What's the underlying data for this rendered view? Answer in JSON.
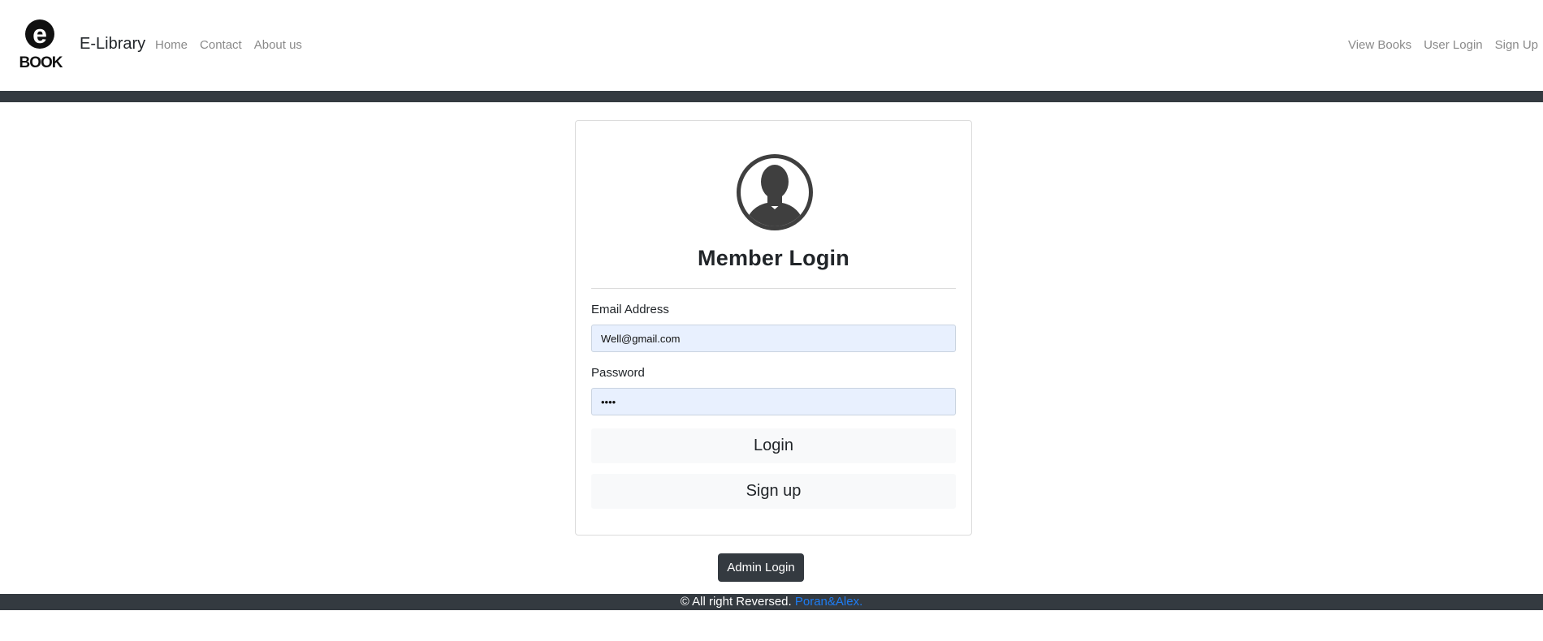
{
  "navbar": {
    "logo_icon": "ebook-logo-icon",
    "logo_letter": "e",
    "logo_word": "BOOK",
    "brand": "E-Library",
    "left_links": [
      "Home",
      "Contact",
      "About us"
    ],
    "right_links": [
      "View Books",
      "User Login",
      "Sign Up"
    ]
  },
  "login_card": {
    "avatar_icon": "user-avatar-icon",
    "title": "Member Login",
    "email_label": "Email Address",
    "email_value": "Well@gmail.com",
    "password_label": "Password",
    "password_value": "••••",
    "login_button": "Login",
    "signup_button": "Sign up"
  },
  "admin_button": "Admin Login",
  "footer": {
    "text": "© All right Reversed.",
    "link": "Poran&Alex."
  },
  "colors": {
    "dark_bar": "#343a40",
    "input_bg": "#e8f0fe",
    "link_blue": "#1e7cf2",
    "nav_link": "#8a8a8a",
    "light_button": "#f8f9fa"
  }
}
